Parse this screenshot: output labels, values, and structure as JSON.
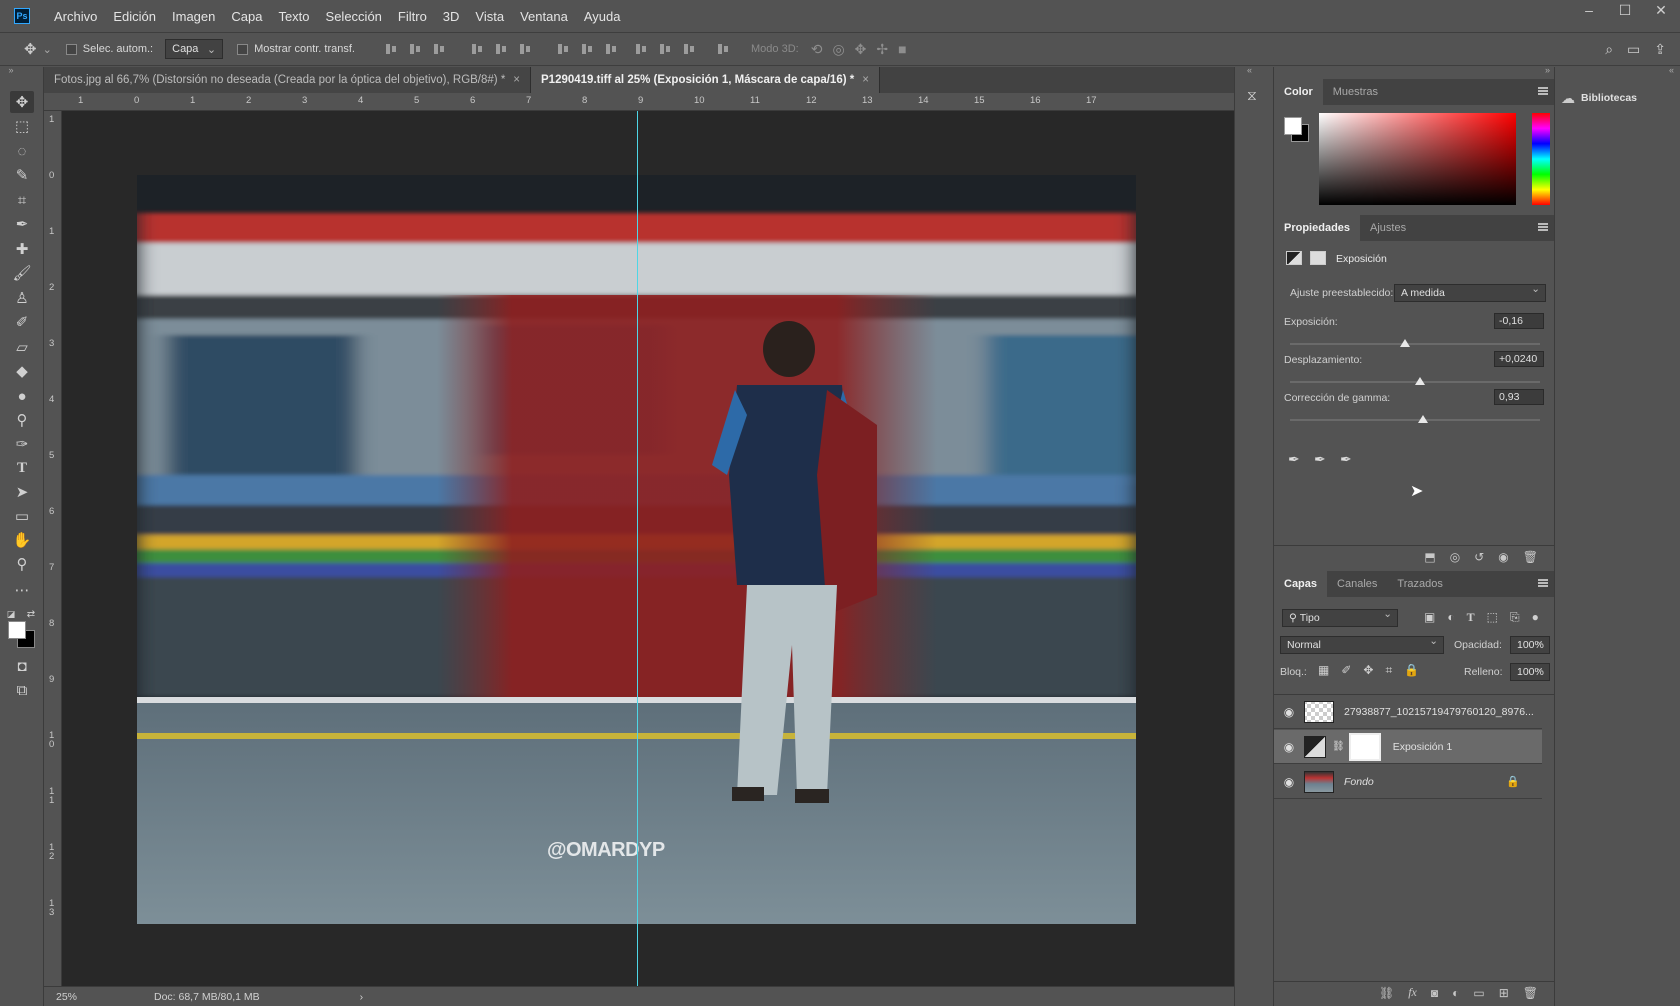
{
  "menubar": {
    "app_icon": "Ps",
    "items": [
      "Archivo",
      "Edición",
      "Imagen",
      "Capa",
      "Texto",
      "Selección",
      "Filtro",
      "3D",
      "Vista",
      "Ventana",
      "Ayuda"
    ]
  },
  "options": {
    "auto_select_label": "Selec. autom.:",
    "auto_select_value": "Capa",
    "show_transform_label": "Mostrar contr. transf.",
    "mode_3d_label": "Modo 3D:"
  },
  "tabs": [
    {
      "label": "Fotos.jpg al 66,7% (Distorsión no deseada (Creada por la óptica del objetivo), RGB/8#) *",
      "close": "×"
    },
    {
      "label": "P1290419.tiff al 25% (Exposición 1, Máscara de capa/16) *",
      "close": "×"
    }
  ],
  "ruler": {
    "top_ticks": [
      "1",
      "0",
      "1",
      "2",
      "3",
      "4",
      "5",
      "6",
      "7",
      "8",
      "9",
      "10",
      "11",
      "12",
      "13",
      "14",
      "15",
      "16",
      "17"
    ],
    "left_ticks": [
      "1",
      "0",
      "1",
      "2",
      "3",
      "4",
      "5",
      "6",
      "7",
      "8",
      "9",
      "1 0",
      "1 1",
      "1 2",
      "1 3"
    ]
  },
  "canvas": {
    "watermark": "@OMARDYP"
  },
  "status": {
    "zoom": "25%",
    "doc": "Doc: 68,7 MB/80,1 MB",
    "arrow": "›"
  },
  "color_panel": {
    "tabs": [
      "Color",
      "Muestras"
    ]
  },
  "properties_panel": {
    "tabs": [
      "Propiedades",
      "Ajustes"
    ],
    "title": "Exposición",
    "preset_label": "Ajuste preestablecido:",
    "preset_value": "A medida",
    "exposure_label": "Exposición:",
    "exposure_value": "-0,16",
    "exposure_level": 0.46,
    "offset_label": "Desplazamiento:",
    "offset_value": "+0,0240",
    "offset_level": 0.52,
    "gamma_label": "Corrección de gamma:",
    "gamma_value": "0,93",
    "gamma_level": 0.53
  },
  "layers_panel": {
    "tabs": [
      "Capas",
      "Canales",
      "Trazados"
    ],
    "filter_value": "Tipo",
    "blend_mode": "Normal",
    "opacity_label": "Opacidad:",
    "opacity_value": "100%",
    "lock_label": "Bloq.:",
    "fill_label": "Relleno:",
    "fill_value": "100%",
    "layers": [
      {
        "name": "27938877_10215719479760120_8976...",
        "selected": false,
        "italic": false
      },
      {
        "name": "Exposición 1",
        "selected": true,
        "italic": false
      },
      {
        "name": "Fondo",
        "selected": false,
        "italic": true
      }
    ],
    "footer_icons": [
      "link-icon",
      "fx-icon",
      "mask-icon",
      "adjustment-icon",
      "group-icon",
      "new-layer-icon",
      "trash-icon"
    ]
  },
  "libraries": {
    "label": "Bibliotecas"
  }
}
